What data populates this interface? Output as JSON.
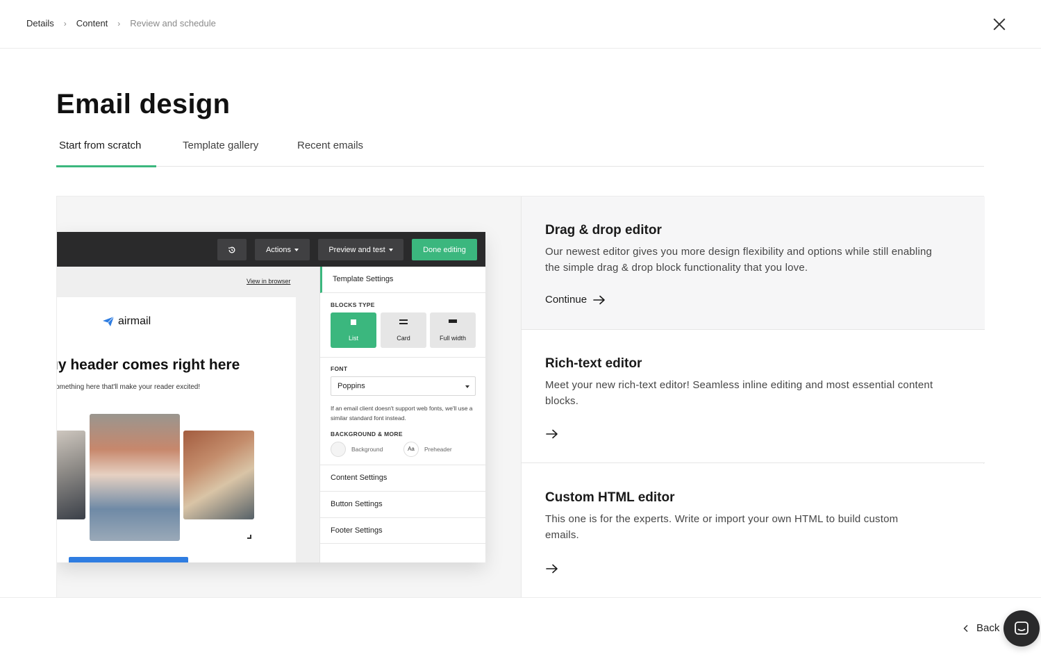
{
  "breadcrumb": {
    "items": [
      {
        "label": "Details"
      },
      {
        "label": "Content"
      },
      {
        "label": "Review and schedule"
      }
    ]
  },
  "page": {
    "title": "Email design"
  },
  "tabs": [
    {
      "label": "Start from scratch",
      "active": true
    },
    {
      "label": "Template gallery",
      "active": false
    },
    {
      "label": "Recent emails",
      "active": false
    }
  ],
  "editor_preview": {
    "toolbar": {
      "history_icon": "history-icon",
      "actions_label": "Actions",
      "preview_label": "Preview and test",
      "done_label": "Done editing"
    },
    "view_in_browser": "View in browser",
    "brand": "airmail",
    "email_header": "ıy header comes right here",
    "email_subheader": "omething here that'll make your reader excited!",
    "sidebar": {
      "template_settings": "Template Settings",
      "blocks_type_label": "BLOCKS TYPE",
      "blocks": [
        {
          "label": "List",
          "selected": true
        },
        {
          "label": "Card",
          "selected": false
        },
        {
          "label": "Full width",
          "selected": false
        }
      ],
      "font_label": "FONT",
      "font_value": "Poppins",
      "font_note": "If an email client doesn't support web fonts, we'll use a similar standard font instead.",
      "background_label": "BACKGROUND & MORE",
      "background_item": "Background",
      "preheader_glyph": "Aa",
      "preheader_item": "Preheader",
      "content_settings": "Content Settings",
      "button_settings": "Button Settings",
      "footer_settings": "Footer Settings"
    }
  },
  "options": [
    {
      "title": "Drag & drop editor",
      "description": "Our newest editor gives you more design flexibility and options while still enabling the simple drag & drop block functionality that you love.",
      "cta": "Continue"
    },
    {
      "title": "Rich-text editor",
      "description": "Meet your new rich-text editor! Seamless inline editing and most essential content blocks.",
      "cta": ""
    },
    {
      "title": "Custom HTML editor",
      "description": "This one is for the experts. Write or import your own HTML to build custom emails.",
      "cta": ""
    }
  ],
  "footer": {
    "back_label": "Back"
  },
  "colors": {
    "accent": "#3bb77e",
    "dark": "#2a2a2b",
    "link_blue": "#2f7de1"
  }
}
